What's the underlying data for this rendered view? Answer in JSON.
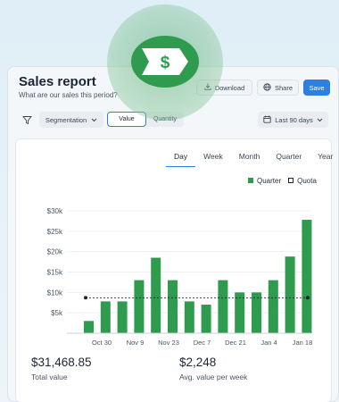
{
  "header": {
    "title": "Sales report",
    "subtitle": "What are our sales this period?",
    "download_label": "Download",
    "share_label": "Share",
    "save_label": "Save"
  },
  "badge": {
    "symbol": "$"
  },
  "filters": {
    "segmentation_label": "Segmentation",
    "toggle": [
      "Value",
      "Quantity"
    ],
    "date_range_label": "Last 90 days"
  },
  "tabs": [
    "Day",
    "Week",
    "Month",
    "Quarter",
    "Year"
  ],
  "legend": {
    "quarter": "Quarter",
    "quota": "Quota"
  },
  "colors": {
    "bar": "#2e9b4e",
    "accent": "#2f7fe0"
  },
  "chart_data": {
    "type": "bar",
    "y_ticks": [
      "$30k",
      "$25k",
      "$20k",
      "$15k",
      "$10k",
      "$5k"
    ],
    "ylim": [
      0,
      30000
    ],
    "x_labels": [
      "Oct 30",
      "Nov 9",
      "Nov 23",
      "Dec 7",
      "Dec 21",
      "Jan 4",
      "Jan 18"
    ],
    "series": [
      {
        "name": "Quarter",
        "values": [
          3000,
          7800,
          7800,
          13000,
          18500,
          13000,
          7800,
          7000,
          13000,
          10000,
          10000,
          13000,
          18800,
          27800
        ]
      },
      {
        "name": "Quota",
        "values": [
          8700,
          8700
        ]
      }
    ]
  },
  "stats": [
    {
      "value": "$31,468.85",
      "label": "Total value"
    },
    {
      "value": "$2,248",
      "label": "Avg. value per week"
    }
  ]
}
